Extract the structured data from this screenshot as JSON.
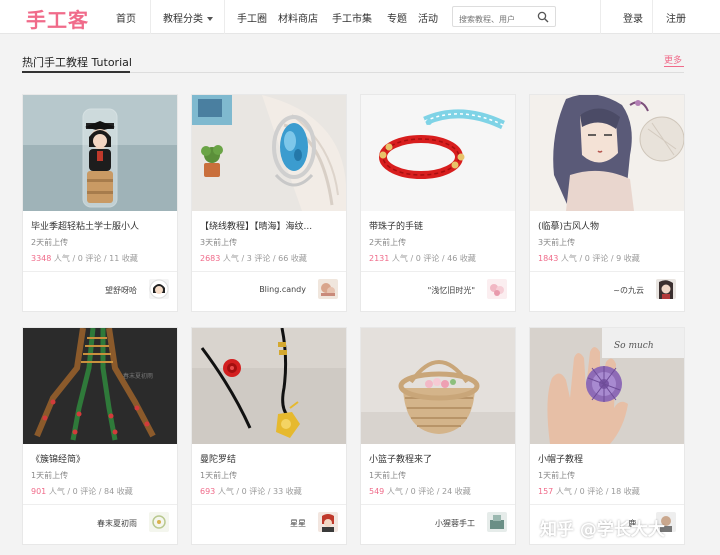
{
  "brand": {
    "logo": "手工客",
    "accent": "#f06b8a"
  },
  "nav": {
    "home": "首页",
    "category": "教程分类",
    "circle": "手工圈",
    "shop": "材料商店",
    "market": "手工市集",
    "topic": "专题",
    "event": "活动",
    "search_placeholder": "搜索教程、用户",
    "login": "登录",
    "register": "注册"
  },
  "section": {
    "title": "热门手工教程  Tutorial",
    "more": "更多"
  },
  "cards": [
    {
      "title": "毕业季超轻粘土学士服小人",
      "time": "2天前上传",
      "views": "3348",
      "views_label": "人气",
      "comments": "0",
      "comments_label": "评论",
      "favs": "11",
      "favs_label": "收藏",
      "author": "望舒呀哈",
      "thumb": "graduate-figure"
    },
    {
      "title": "【绕线教程】【晴海】海纹...",
      "time": "3天前上传",
      "views": "2683",
      "views_label": "人气",
      "comments": "3",
      "comments_label": "评论",
      "favs": "66",
      "favs_label": "收藏",
      "author": "Bling.candy",
      "thumb": "wire-pendant"
    },
    {
      "title": "带珠子的手链",
      "time": "2天前上传",
      "views": "2131",
      "views_label": "人气",
      "comments": "0",
      "comments_label": "评论",
      "favs": "46",
      "favs_label": "收藏",
      "author": "\"浅忆旧时光\"",
      "thumb": "bead-bracelet"
    },
    {
      "title": "(临摹)古风人物",
      "time": "3天前上传",
      "views": "1843",
      "views_label": "人气",
      "comments": "0",
      "comments_label": "评论",
      "favs": "9",
      "favs_label": "收藏",
      "author": "~の九云",
      "thumb": "ancient-portrait"
    },
    {
      "title": "《簇锦经简》",
      "time": "1天前上传",
      "views": "901",
      "views_label": "人气",
      "comments": "0",
      "comments_label": "评论",
      "favs": "84",
      "favs_label": "收藏",
      "author": "春末夏初雨",
      "thumb": "tassel-knot"
    },
    {
      "title": "曼陀罗结",
      "time": "1天前上传",
      "views": "693",
      "views_label": "人气",
      "comments": "0",
      "comments_label": "评论",
      "favs": "33",
      "favs_label": "收藏",
      "author": "星星",
      "thumb": "mandala-knot"
    },
    {
      "title": "小篮子教程来了",
      "time": "1天前上传",
      "views": "549",
      "views_label": "人气",
      "comments": "0",
      "comments_label": "评论",
      "favs": "24",
      "favs_label": "收藏",
      "author": "小猩蓉手工",
      "thumb": "paper-basket"
    },
    {
      "title": "小帽子教程",
      "time": "1天前上传",
      "views": "157",
      "views_label": "人气",
      "comments": "0",
      "comments_label": "评论",
      "favs": "18",
      "favs_label": "收藏",
      "author": "鹿...",
      "thumb": "tiny-hat"
    }
  ],
  "watermark": "知乎 @学长大大"
}
